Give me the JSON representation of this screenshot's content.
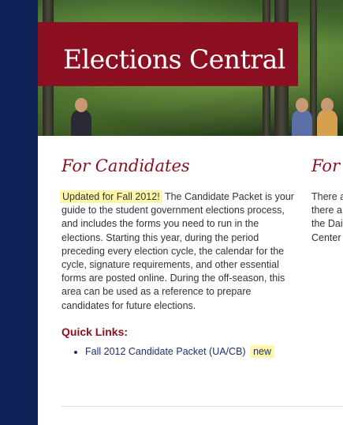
{
  "header": {
    "title": "Elections Central"
  },
  "candidates": {
    "heading": "For Candidates",
    "updated_badge": "Updated for Fall 2012!",
    "body": "The Candidate Packet is your guide to the student government elections process, and includes the forms you need to run in the elections. Starting this year, during the period preceding every election cycle, the calendar for the cycle, signature requirements, and other essential forms are posted online. During the off-season, this area can be used as a reference to prepare candidates for future elections.",
    "quick_links_title": "Quick Links:",
    "links": [
      {
        "label": "Fall 2012 Candidate Packet (UA/CB)",
        "badge": "new"
      }
    ]
  },
  "side": {
    "heading": "For",
    "lines": [
      "There a",
      "there a",
      "the Dai",
      "Center"
    ]
  },
  "colors": {
    "brand": "#8c1022",
    "nav": "#0f2257",
    "highlight": "#fff6a8",
    "link": "#1f2f6b"
  }
}
